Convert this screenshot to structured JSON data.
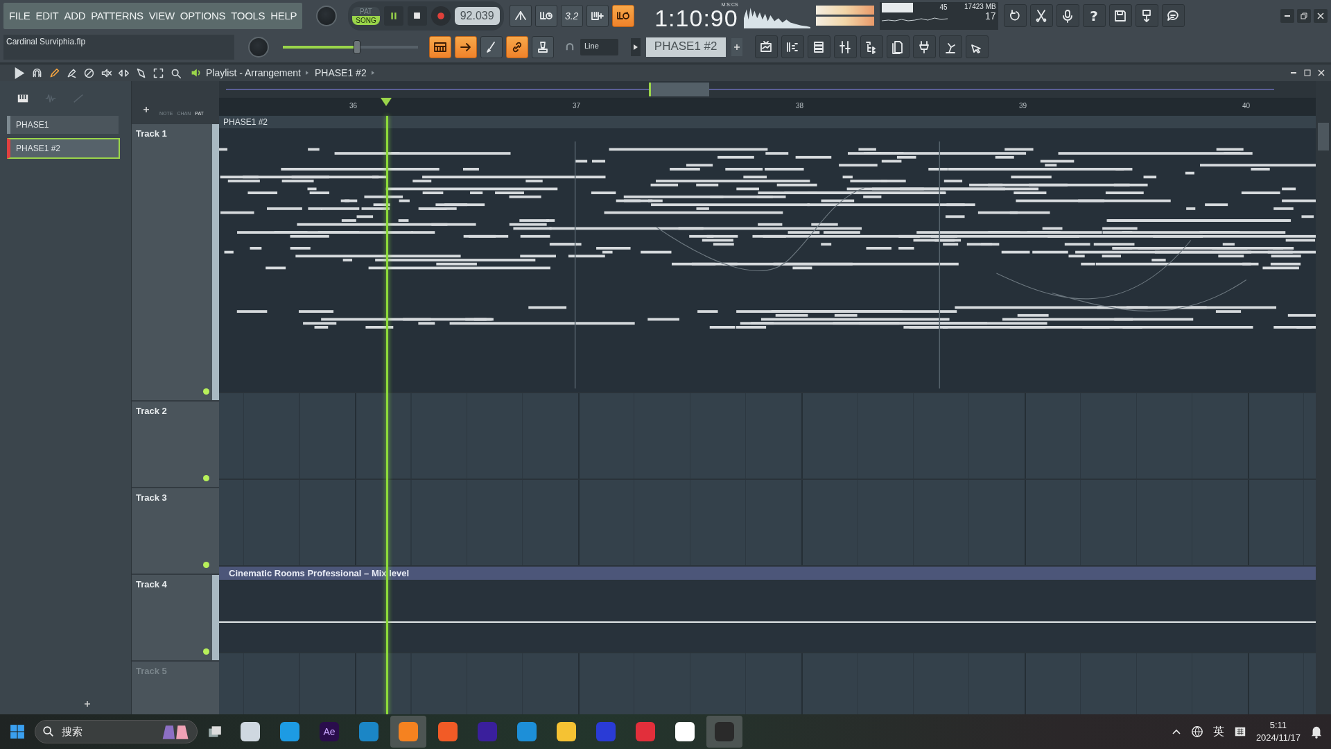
{
  "menu": [
    "FILE",
    "EDIT",
    "ADD",
    "PATTERNS",
    "VIEW",
    "OPTIONS",
    "TOOLS",
    "HELP"
  ],
  "transport": {
    "pat": "PAT",
    "song": "SONG",
    "song_selected": true,
    "tempo": "92.039",
    "time": "1:10:90",
    "time_unit": "M:S:CS"
  },
  "record_tools": [
    {
      "on": false
    },
    {
      "on": false
    },
    {
      "label": "3.2",
      "on": false
    },
    {
      "on": false
    },
    {
      "on": true
    }
  ],
  "monitor": {
    "cpu": "45",
    "memory": "17423 MB",
    "polyphony": "17"
  },
  "help_button": "?",
  "project_file": "Cardinal Surviphia.flp",
  "master_pitch": {
    "level": 0.55
  },
  "edit_tools": [
    {
      "on": true
    },
    {
      "on": true
    },
    {
      "on": false
    },
    {
      "on": true
    },
    {
      "on": false
    }
  ],
  "snap": "Line",
  "pattern_selector": "PHASE1 #2",
  "playlist": {
    "tools": [
      {
        "selected": false
      },
      {
        "selected": false
      },
      {
        "selected": true
      },
      {
        "selected": false
      },
      {
        "selected": false
      },
      {
        "selected": false
      },
      {
        "selected": false
      },
      {
        "selected": false
      },
      {
        "selected": false
      },
      {
        "selected": false
      }
    ],
    "breadcrumb": [
      "Playlist - Arrangement",
      "PHASE1 #2"
    ],
    "picker_labels": [
      "NOTE",
      "CHAN",
      "PAT"
    ],
    "patterns": [
      {
        "name": "PHASE1",
        "selected": false
      },
      {
        "name": "PHASE1 #2",
        "selected": true
      }
    ],
    "ruler": [
      "36",
      "37",
      "38",
      "39",
      "40"
    ],
    "tracks": [
      {
        "name": "Track 1",
        "dimmed": false,
        "clip": {
          "kind": "pattern",
          "title": "PHASE1 #2"
        }
      },
      {
        "name": "Track 2",
        "dimmed": false
      },
      {
        "name": "Track 3",
        "dimmed": false
      },
      {
        "name": "Track 4",
        "dimmed": false,
        "clip": {
          "kind": "automation",
          "title": "Cinematic Rooms Professional – Mix level"
        }
      },
      {
        "name": "Track 5",
        "dimmed": true
      }
    ]
  },
  "taskbar": {
    "search_placeholder": "搜索",
    "apps": [
      {
        "active": false
      },
      {
        "active": false
      },
      {
        "label": "Ae",
        "active": false
      },
      {
        "active": false
      },
      {
        "active": true
      },
      {
        "active": false
      },
      {
        "active": false
      },
      {
        "active": false
      },
      {
        "active": false
      },
      {
        "active": false
      },
      {
        "active": false
      },
      {
        "active": false
      },
      {
        "active": true
      }
    ],
    "ime": "英",
    "time": "5:11",
    "date": "2024/11/17"
  }
}
